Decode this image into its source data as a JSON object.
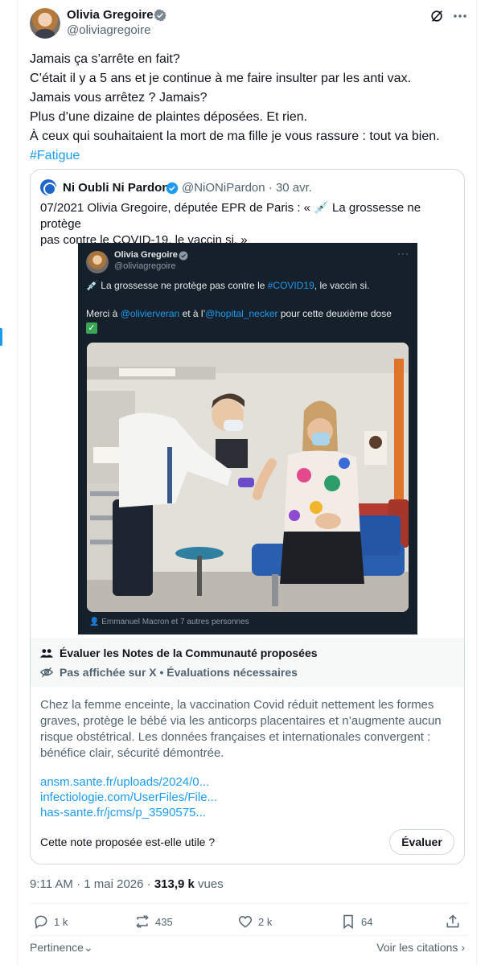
{
  "author": {
    "name": "Olivia Gregoire",
    "handle": "@oliviagregoire",
    "avatar_icon": "avatar-photo",
    "verified_icon": "verified-badge-icon"
  },
  "header_icons": [
    "grok-icon",
    "more-icon"
  ],
  "tweet": {
    "lines": [
      "Jamais ça s’arrête en fait?",
      "C’était il y a 5 ans et je continue à me faire insulter par les anti vax.",
      "Jamais vous arrêtez ? Jamais?",
      "Plus d’une dizaine de plaintes déposées. Et rien.",
      "À ceux qui souhaitaient la mort de ma fille je vous rassure : tout va bien."
    ],
    "hashtag": "#Fatigue"
  },
  "quote": {
    "name": "Ni Oubli Ni Pardon",
    "handle": "@NiONiPardon",
    "date": "30 avr.",
    "text_line1": "07/2021 Olivia Gregoire, députée EPR de Paris : « 💉 La grossesse ne protège",
    "text_line2": "pas contre le COVID-19, le vaccin si. »",
    "screenshot": {
      "name": "Olivia Gregoire",
      "handle": "@oliviagregoire",
      "more": "···",
      "line1_prefix": "💉 La grossesse ne protège pas contre le ",
      "line1_link": "#COVID19",
      "line1_suffix": ", le vaccin si.",
      "line2_prefix": "Merci à ",
      "line2_link1": "@olivierveran",
      "line2_middle": " et à l’",
      "line2_link2": "@hopital_necker",
      "line2_suffix": " pour cette deuxième dose",
      "check": "✓",
      "tagged": "Emmanuel Macron et 7 autres personnes"
    }
  },
  "community_notes": {
    "header": "Évaluer les Notes de la Communauté proposées",
    "status": "Pas affichée sur X • Évaluations nécessaires",
    "body_lines": [
      "Chez la femme enceinte, la vaccination Covid réduit nettement les formes",
      "graves, protège le bébé via les anticorps placentaires et n’augmente aucun",
      "risque obstétrical. Les données françaises et internationales convergent :",
      "bénéfice clair, sécurité démontrée."
    ],
    "links": [
      "ansm.sante.fr/uploads/2024/0...",
      "infectiologie.com/UserFiles/File...",
      "has-sante.fr/jcms/p_3590575..."
    ],
    "question": "Cette note proposée est-elle utile ?",
    "rate_button": "Évaluer"
  },
  "meta": {
    "time": "9:11 AM",
    "date": "1 mai 2026",
    "views_count": "313,9 k",
    "views_label": "vues"
  },
  "actions": {
    "replies": "1 k",
    "reposts": "435",
    "likes": "2 k",
    "bookmarks": "64"
  },
  "footer": {
    "sort_label": "Pertinence",
    "citations_label": "Voir les citations"
  },
  "colors": {
    "accent": "#1d9bf0",
    "text": "#0f1419",
    "muted": "#536471",
    "border": "#cfd9de",
    "dark_card": "#15202b"
  }
}
